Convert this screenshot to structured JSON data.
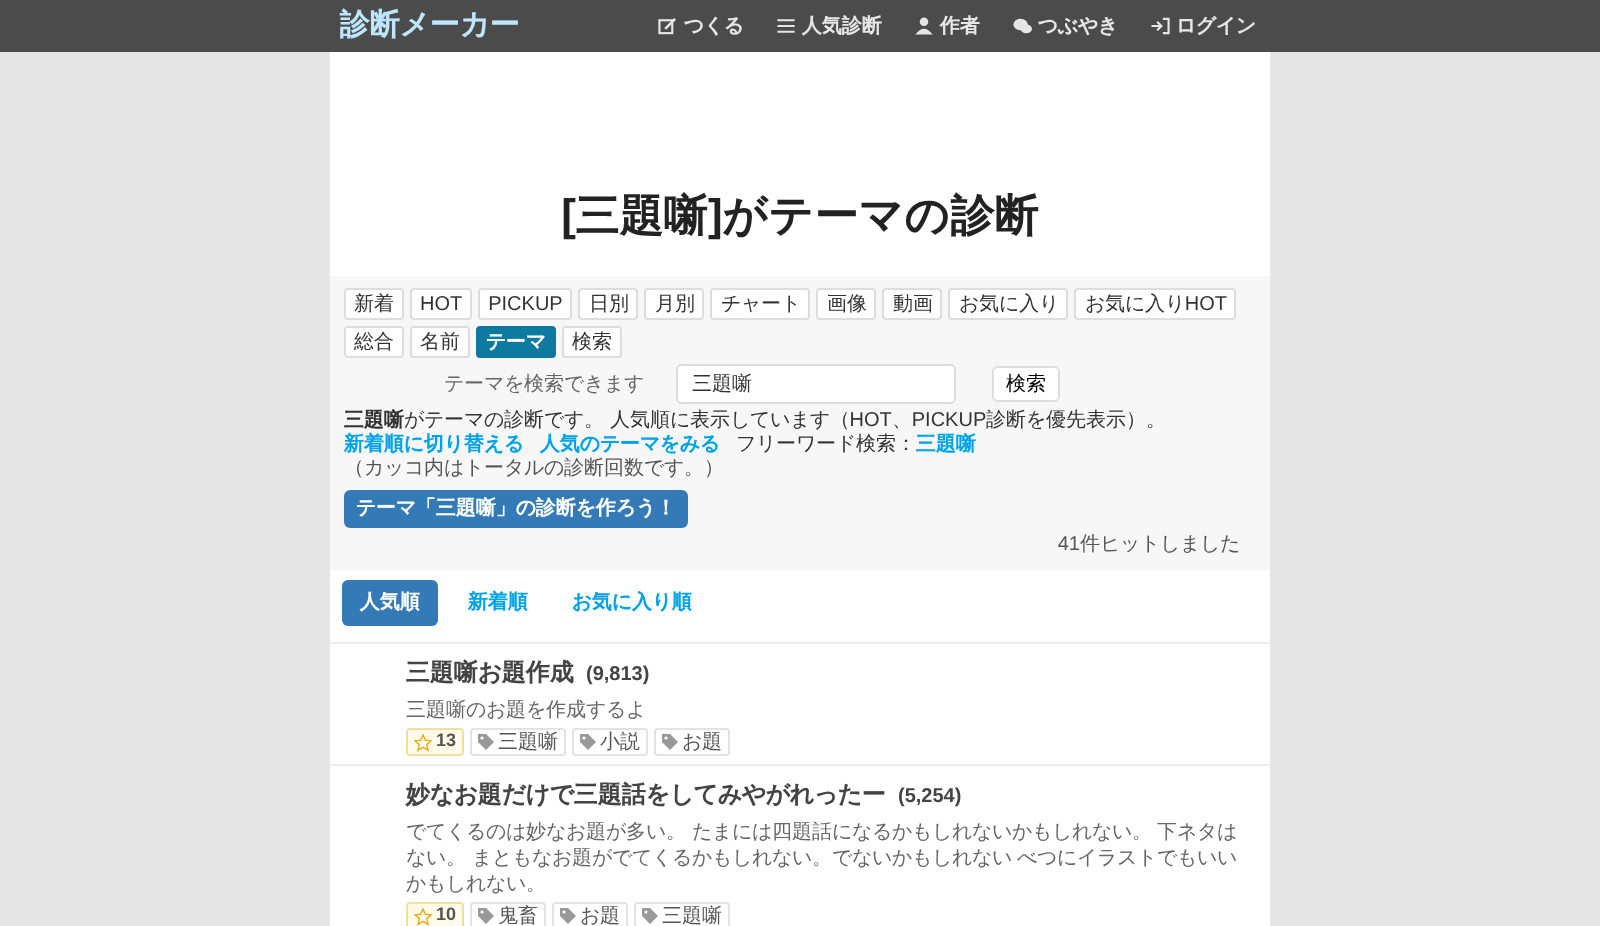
{
  "nav": {
    "logo": "診断メーカー",
    "items": [
      {
        "label": "つくる"
      },
      {
        "label": "人気診断"
      },
      {
        "label": "作者"
      },
      {
        "label": "つぶやき"
      },
      {
        "label": "ログイン"
      }
    ]
  },
  "title": "[三題噺]がテーマの診断",
  "filter_tabs": [
    {
      "label": "新着",
      "selected": false
    },
    {
      "label": "HOT",
      "selected": false
    },
    {
      "label": "PICKUP",
      "selected": false
    },
    {
      "label": "日別",
      "selected": false
    },
    {
      "label": "月別",
      "selected": false
    },
    {
      "label": "チャート",
      "selected": false
    },
    {
      "label": "画像",
      "selected": false
    },
    {
      "label": "動画",
      "selected": false
    },
    {
      "label": "お気に入り",
      "selected": false
    },
    {
      "label": "お気に入りHOT",
      "selected": false
    },
    {
      "label": "総合",
      "selected": false
    },
    {
      "label": "名前",
      "selected": false
    },
    {
      "label": "テーマ",
      "selected": true
    },
    {
      "label": "検索",
      "selected": false
    }
  ],
  "search": {
    "label": "テーマを検索できます",
    "value": "三題噺",
    "button": "検索"
  },
  "info": {
    "description": "**三題噺**がテーマの診断です。 人気順に表示しています（HOT、PICKUP診断を優先表示）。",
    "links": [
      {
        "kind": "link",
        "label": "新着順に切り替える"
      },
      {
        "kind": "link",
        "label": "人気のテーマをみる"
      },
      {
        "kind": "search",
        "label": "フリーワード検索：",
        "term": "三題噺"
      }
    ],
    "note": "（カッコ内はトータルの診断回数です。）",
    "create_button": "テーマ「三題噺」の診断を作ろう！",
    "hits": "41件ヒットしました"
  },
  "sort_tabs": [
    {
      "label": "人気順",
      "selected": true
    },
    {
      "label": "新着順",
      "selected": false
    },
    {
      "label": "お気に入り順",
      "selected": false
    }
  ],
  "results": [
    {
      "title": "三題噺お題作成",
      "count": "(9,813)",
      "description": "三題噺のお題を作成するよ",
      "favorites": "13",
      "tags": [
        "三題噺",
        "小説",
        "お題"
      ]
    },
    {
      "title": "妙なお題だけで三題話をしてみやがれったー",
      "count": "(5,254)",
      "description": "でてくるのは妙なお題が多い。 たまには四題話になるかもしれないかもしれない。 下ネタはない。 まともなお題がでてくるかもしれない。でないかもしれない べつにイラストでもいいかもしれない。",
      "favorites": "10",
      "tags": [
        "鬼畜",
        "お題",
        "三題噺"
      ]
    }
  ]
}
